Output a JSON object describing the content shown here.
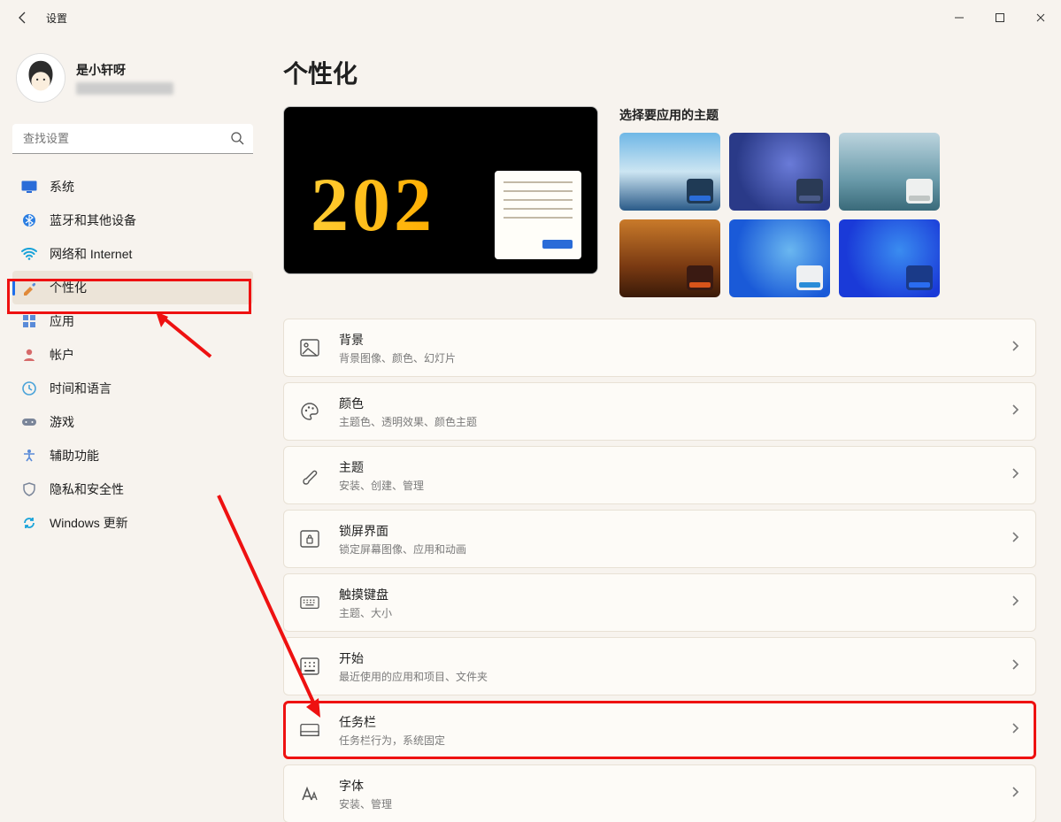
{
  "window": {
    "title": "设置"
  },
  "user": {
    "name": "是小轩呀"
  },
  "search": {
    "placeholder": "查找设置"
  },
  "sidebar": {
    "items": [
      {
        "label": "系统"
      },
      {
        "label": "蓝牙和其他设备"
      },
      {
        "label": "网络和 Internet"
      },
      {
        "label": "个性化"
      },
      {
        "label": "应用"
      },
      {
        "label": "帐户"
      },
      {
        "label": "时间和语言"
      },
      {
        "label": "游戏"
      },
      {
        "label": "辅助功能"
      },
      {
        "label": "隐私和安全性"
      },
      {
        "label": "Windows 更新"
      }
    ]
  },
  "page": {
    "title": "个性化",
    "preview_year": "202",
    "theme_picker_title": "选择要应用的主题"
  },
  "settings": [
    {
      "title": "背景",
      "desc": "背景图像、颜色、幻灯片"
    },
    {
      "title": "颜色",
      "desc": "主题色、透明效果、颜色主题"
    },
    {
      "title": "主题",
      "desc": "安装、创建、管理"
    },
    {
      "title": "锁屏界面",
      "desc": "锁定屏幕图像、应用和动画"
    },
    {
      "title": "触摸键盘",
      "desc": "主题、大小"
    },
    {
      "title": "开始",
      "desc": "最近使用的应用和项目、文件夹"
    },
    {
      "title": "任务栏",
      "desc": "任务栏行为，系统固定"
    },
    {
      "title": "字体",
      "desc": "安装、管理"
    }
  ]
}
